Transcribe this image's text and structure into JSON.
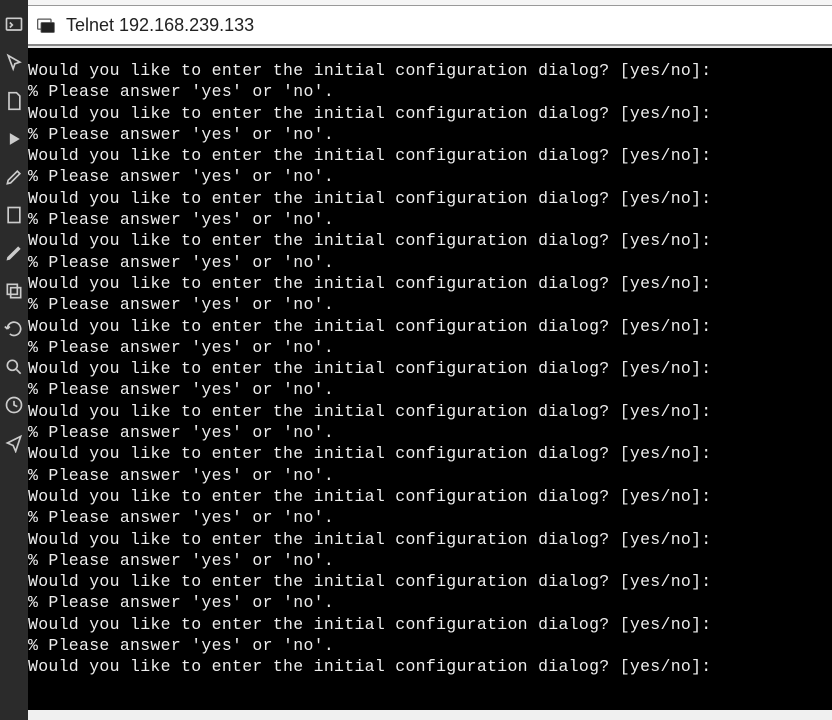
{
  "window": {
    "title": "Telnet 192.168.239.133"
  },
  "terminal": {
    "prompt_line": "Would you like to enter the initial configuration dialog? [yes/no]:",
    "error_line": "% Please answer 'yes' or 'no'.",
    "repeat_pairs": 14,
    "trailing_prompt": true
  },
  "sidebar": {
    "icons": [
      "terminal-icon",
      "cursor-icon",
      "doc-icon",
      "play-icon",
      "edit-icon",
      "file-icon",
      "pen-icon",
      "copy-icon",
      "refresh-icon",
      "search-icon",
      "history-icon",
      "share-icon"
    ]
  }
}
